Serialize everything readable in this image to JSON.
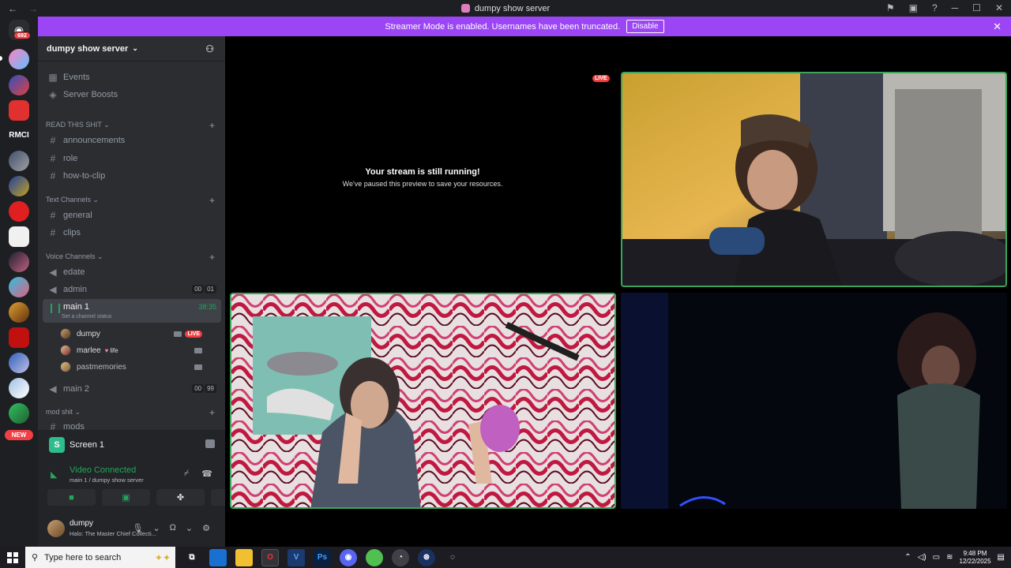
{
  "window": {
    "title": "dumpy show server",
    "nav_back": "←",
    "nav_forward": "→",
    "buttons": [
      "⚑",
      "▣",
      "?",
      "─",
      "☐",
      "✕"
    ]
  },
  "banner": {
    "text": "Streamer Mode is enabled. Usernames have been truncated.",
    "disable_label": "Disable",
    "close": "✕"
  },
  "servers": {
    "home_badge": "692",
    "rmci_label": "RMCI",
    "new_label": "NEW"
  },
  "sidebar": {
    "server_name": "dumpy show server",
    "events": "Events",
    "server_boosts": "Server Boosts",
    "categories": {
      "read": "READ THIS SHIT",
      "text": "Text Channels",
      "voice": "Voice Channels",
      "mod": "mod shit"
    },
    "channels": {
      "announcements": "announcements",
      "role": "role",
      "how_to_clip": "how-to-clip",
      "general": "general",
      "clips": "clips",
      "mods": "mods"
    },
    "voice": {
      "edate": "edate",
      "admin": "admin",
      "admin_count": [
        "00",
        "01"
      ],
      "main1": "main 1",
      "main1_timer": "38:35",
      "main1_status": "Set a channel status",
      "main2": "main 2",
      "main2_count": [
        "00",
        "99"
      ]
    },
    "voice_users": [
      {
        "name": "dumpy",
        "live": "LIVE"
      },
      {
        "name": "marlee",
        "tag": "life"
      },
      {
        "name": "pastmemories"
      }
    ]
  },
  "panel": {
    "screen_title": "Screen 1",
    "video_connected": "Video Connected",
    "connection_path": "main 1 / dumpy show server",
    "user_name": "dumpy",
    "user_status": "Halo: The Master Chief Collecti..."
  },
  "stage": {
    "paused_title": "Your stream is still running!",
    "paused_subtitle": "We've paused this preview to save your resources.",
    "live_label": "LIVE"
  },
  "taskbar": {
    "search_placeholder": "Type here to search",
    "time": "9:48 PM",
    "date": "12/22/2025"
  },
  "colors": {
    "accent": "#9b45f5",
    "online": "#23a55a",
    "live": "#f23f43"
  }
}
